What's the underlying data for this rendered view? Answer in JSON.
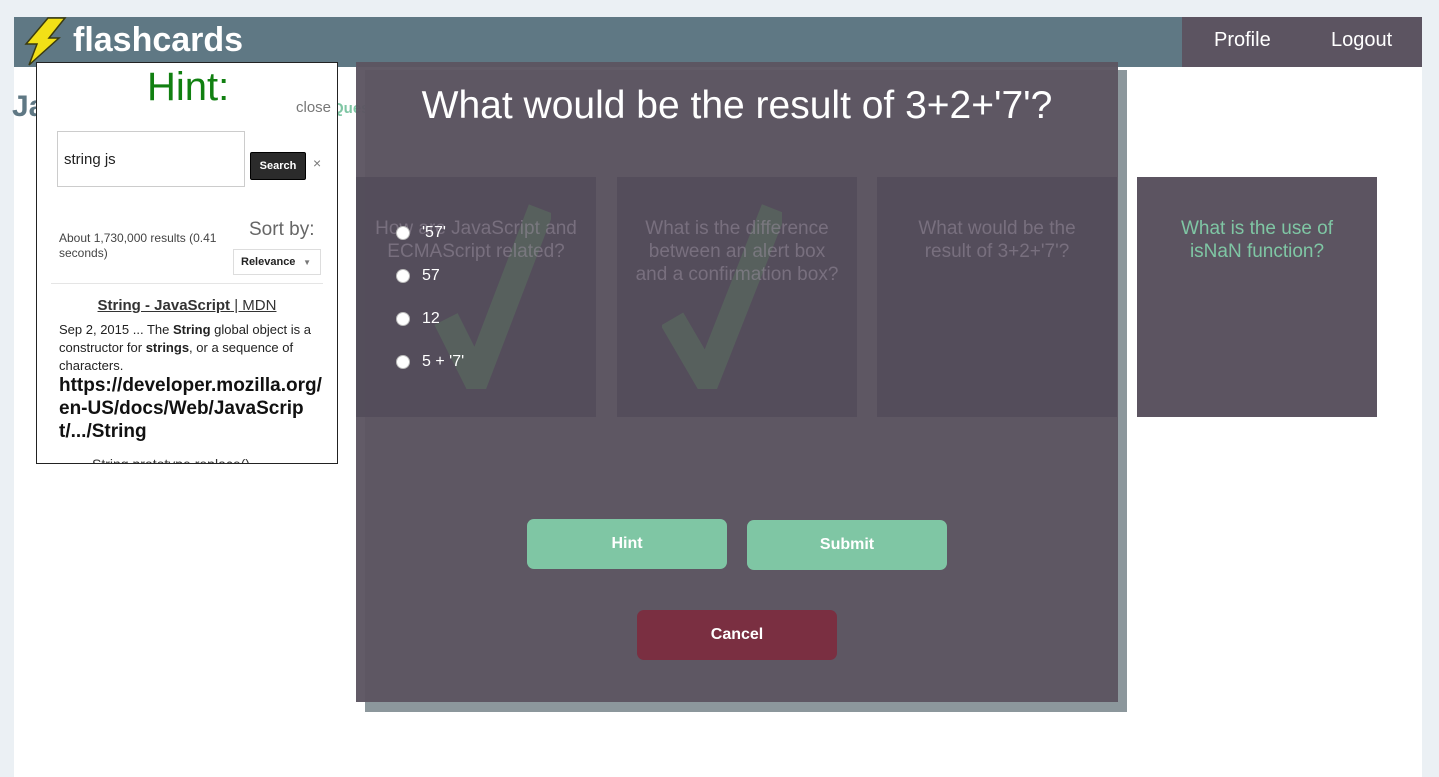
{
  "header": {
    "brand": "flashcards",
    "nav": {
      "profile": "Profile",
      "logout": "Logout"
    }
  },
  "page": {
    "title_fragment": "Ja",
    "questions_fragment": "Questi"
  },
  "cards": [
    {
      "text": "How are JavaScript and ECMAScript related?"
    },
    {
      "text": "What is the difference between an alert box and a confirmation box?"
    },
    {
      "text": "What would be the result of 3+2+'7'?"
    },
    {
      "text": "What is the use of isNaN function?"
    }
  ],
  "modal": {
    "question": "What would be the result of 3+2+'7'?",
    "options": [
      "'57'",
      "57",
      "12",
      "5 + '7'"
    ],
    "buttons": {
      "hint": "Hint",
      "submit": "Submit",
      "cancel": "Cancel"
    }
  },
  "hint_panel": {
    "title": "Hint:",
    "close": "close",
    "search_value": "string js",
    "search_button": "Search",
    "clear": "×",
    "results_count": "About 1,730,000 results (0.41 seconds)",
    "sort_by": "Sort by:",
    "sort_value": "Relevance",
    "result": {
      "title_bold": "String - JavaScript",
      "title_site": " | MDN",
      "snippet_date": "Sep 2, 2015 ... The ",
      "snippet_b1": "String",
      "snippet_mid": " global object is a constructor for ",
      "snippet_b2": "strings",
      "snippet_end": ", or a sequence of characters.",
      "url": "https://developer.mozilla.org/en-US/docs/Web/JavaScript/.../String"
    },
    "next_result": "String.prototype.replace()"
  },
  "colors": {
    "header": "#5f7884",
    "card": "#5c5461",
    "accent": "#7fc6a4",
    "cancel": "#7a2f41",
    "hint_title": "#118011"
  }
}
